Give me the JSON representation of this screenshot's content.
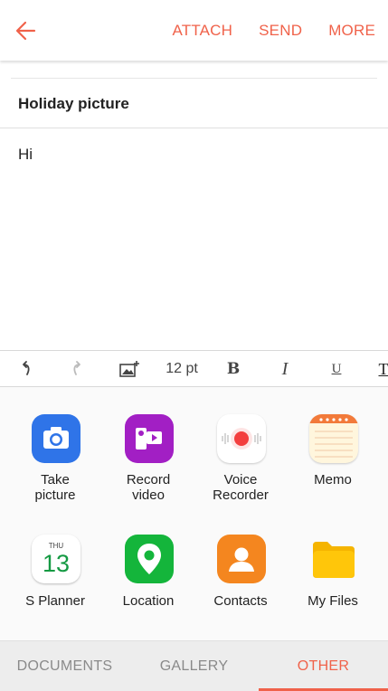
{
  "appbar": {
    "actions": [
      "ATTACH",
      "SEND",
      "MORE"
    ]
  },
  "compose": {
    "subject": "Holiday picture",
    "body": "Hi"
  },
  "toolbar": {
    "font_size": "12 pt",
    "bold": "B",
    "italic": "I",
    "underline": "U",
    "text_color": "T"
  },
  "attach_options": [
    {
      "label": "Take\npicture",
      "icon": "camera-icon"
    },
    {
      "label": "Record\nvideo",
      "icon": "video-camera-icon"
    },
    {
      "label": "Voice\nRecorder",
      "icon": "voice-recorder-icon"
    },
    {
      "label": "Memo",
      "icon": "memo-icon"
    },
    {
      "label": "S Planner",
      "icon": "calendar-icon",
      "calendar_day": "THU",
      "calendar_date": "13"
    },
    {
      "label": "Location",
      "icon": "location-pin-icon"
    },
    {
      "label": "Contacts",
      "icon": "contacts-icon"
    },
    {
      "label": "My Files",
      "icon": "folder-icon"
    }
  ],
  "tabs": [
    {
      "label": "DOCUMENTS",
      "active": false
    },
    {
      "label": "GALLERY",
      "active": false
    },
    {
      "label": "OTHER",
      "active": true
    }
  ],
  "colors": {
    "accent": "#f0624a",
    "camera": "#2f74e8",
    "video": "#a21fc4",
    "location": "#14b53b",
    "contacts": "#f4861f",
    "folder": "#ffc60a"
  }
}
